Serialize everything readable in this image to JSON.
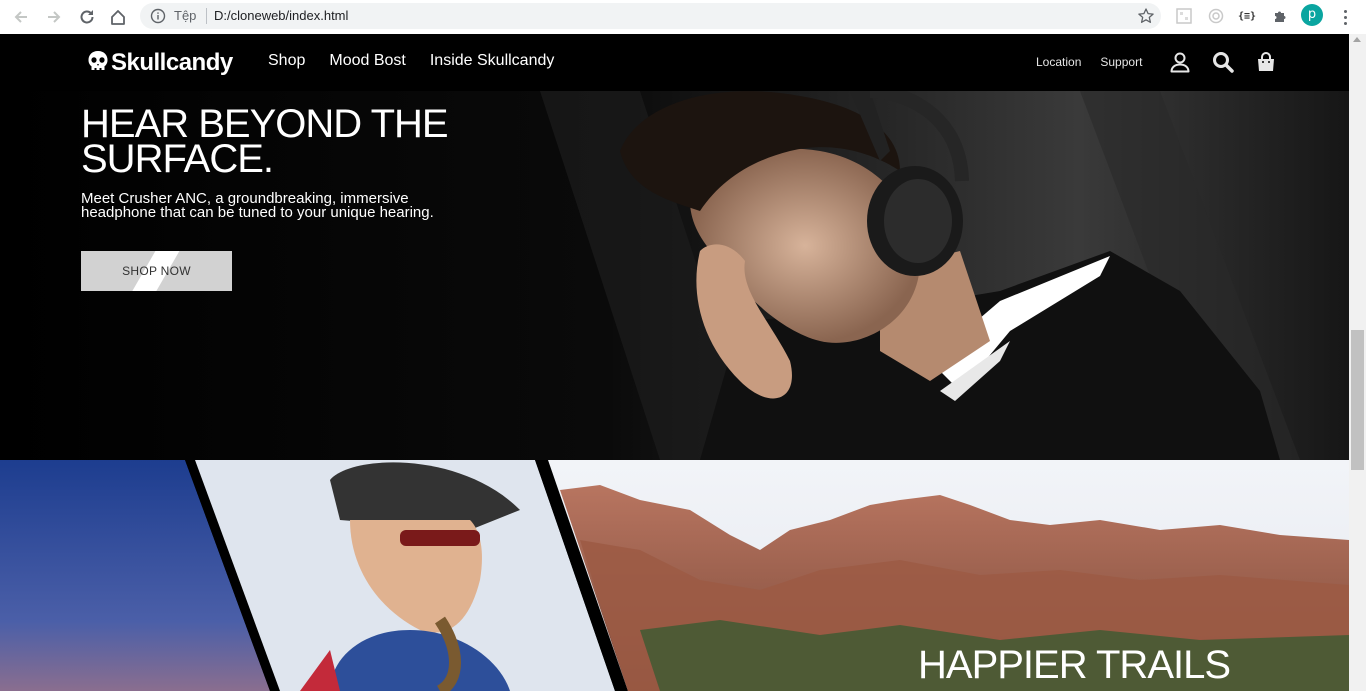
{
  "browser": {
    "scheme_label": "Tệp",
    "url": "D:/cloneweb/index.html",
    "profile_initial": "p",
    "extension_json_label": "{≡}"
  },
  "site": {
    "logo_text": "Skullcandy",
    "nav": [
      "Shop",
      "Mood Bost",
      "Inside Skullcandy"
    ],
    "utility": [
      "Location",
      "Support"
    ]
  },
  "hero": {
    "title_line1": "HEAR BEYOND THE",
    "title_line2": "SURFACE.",
    "description": "Meet Crusher ANC, a groundbreaking, immersive headphone that can be tuned to your unique hearing.",
    "cta": "SHOP NOW"
  },
  "trail": {
    "title": "HAPPIER TRAILS"
  },
  "colors": {
    "brand_bg": "#000000",
    "button_bg": "#d2d2d2",
    "profile": "#0aa5a0"
  },
  "icons": [
    "back-icon",
    "forward-icon",
    "reload-icon",
    "home-icon",
    "info-icon",
    "star-icon",
    "extension-icon",
    "puzzle-icon",
    "skull-logo-icon",
    "user-icon",
    "search-icon",
    "bag-icon"
  ]
}
